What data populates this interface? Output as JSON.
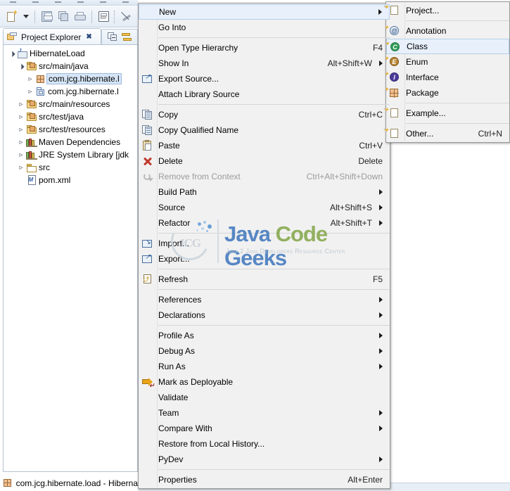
{
  "window": {
    "background_color": "#ffffff",
    "menu_bg": "#f1f1f1",
    "highlight_color": "#e8f0fb",
    "selection_color": "#d6e6f7"
  },
  "toolbar": {
    "items": [
      {
        "name": "new-wizard",
        "icon": "new-wizard-icon",
        "label": "New"
      },
      {
        "name": "new-dropdown",
        "icon": "chevron-down-icon",
        "label": ""
      },
      {
        "name": "save",
        "icon": "save-icon",
        "label": "Save"
      },
      {
        "name": "save-all",
        "icon": "save-all-icon",
        "label": "Save All"
      },
      {
        "name": "print",
        "icon": "print-icon",
        "label": "Print"
      },
      {
        "name": "binary",
        "icon": "binary-icon",
        "label": "Toggle Binary"
      },
      {
        "name": "skip-breakpoints",
        "icon": "skip-breakpoints-icon",
        "label": "Skip All Breakpoints"
      }
    ]
  },
  "view": {
    "tab_label": "Project Explorer",
    "close_glyph": "✖",
    "toolbar": [
      {
        "name": "collapse-all",
        "icon": "collapse-all-icon"
      },
      {
        "name": "link-with-editor",
        "icon": "link-with-editor-icon"
      }
    ]
  },
  "tree": {
    "items": [
      {
        "label": "HibernateLoad",
        "icon": "java-project-icon",
        "indent": 0,
        "twisty": "open",
        "selected": false
      },
      {
        "label": "src/main/java",
        "icon": "source-folder-icon",
        "indent": 1,
        "twisty": "open",
        "selected": false
      },
      {
        "label": "com.jcg.hibernate.l",
        "icon": "package-icon",
        "indent": 2,
        "twisty": "closed",
        "selected": true
      },
      {
        "label": "com.jcg.hibernate.l",
        "icon": "package-object-icon",
        "indent": 2,
        "twisty": "closed",
        "selected": false
      },
      {
        "label": "src/main/resources",
        "icon": "source-folder-icon",
        "indent": 1,
        "twisty": "closed",
        "selected": false
      },
      {
        "label": "src/test/java",
        "icon": "source-folder-icon",
        "indent": 1,
        "twisty": "closed",
        "selected": false
      },
      {
        "label": "src/test/resources",
        "icon": "source-folder-icon",
        "indent": 1,
        "twisty": "closed",
        "selected": false
      },
      {
        "label": "Maven Dependencies",
        "icon": "library-icon",
        "indent": 1,
        "twisty": "closed",
        "selected": false
      },
      {
        "label": "JRE System Library [jdk",
        "icon": "library-icon",
        "indent": 1,
        "twisty": "closed",
        "selected": false
      },
      {
        "label": "src",
        "icon": "folder-icon",
        "indent": 1,
        "twisty": "closed",
        "selected": false
      },
      {
        "label": "pom.xml",
        "icon": "xml-file-icon",
        "indent": 1,
        "twisty": "none",
        "selected": false
      }
    ]
  },
  "status_bar": {
    "icon": "package-icon",
    "text": "com.jcg.hibernate.load - Hiberna"
  },
  "context_menu": {
    "items": [
      {
        "type": "item",
        "label": "New",
        "accel": "",
        "icon": "",
        "submenu": true,
        "highlighted": true,
        "disabled": false
      },
      {
        "type": "item",
        "label": "Go Into",
        "accel": "",
        "icon": "",
        "submenu": false,
        "highlighted": false,
        "disabled": false
      },
      {
        "type": "sep"
      },
      {
        "type": "item",
        "label": "Open Type Hierarchy",
        "accel": "F4",
        "icon": "",
        "submenu": false,
        "highlighted": false,
        "disabled": false
      },
      {
        "type": "item",
        "label": "Show In",
        "accel": "Alt+Shift+W",
        "icon": "",
        "submenu": true,
        "highlighted": false,
        "disabled": false
      },
      {
        "type": "item",
        "label": "Export Source...",
        "accel": "",
        "icon": "export-source-icon",
        "submenu": false,
        "highlighted": false,
        "disabled": false
      },
      {
        "type": "item",
        "label": "Attach Library Source",
        "accel": "",
        "icon": "",
        "submenu": false,
        "highlighted": false,
        "disabled": false
      },
      {
        "type": "sep"
      },
      {
        "type": "item",
        "label": "Copy",
        "accel": "Ctrl+C",
        "icon": "copy-icon",
        "submenu": false,
        "highlighted": false,
        "disabled": false
      },
      {
        "type": "item",
        "label": "Copy Qualified Name",
        "accel": "",
        "icon": "copy-qualified-icon",
        "submenu": false,
        "highlighted": false,
        "disabled": false
      },
      {
        "type": "item",
        "label": "Paste",
        "accel": "Ctrl+V",
        "icon": "paste-icon",
        "submenu": false,
        "highlighted": false,
        "disabled": false
      },
      {
        "type": "item",
        "label": "Delete",
        "accel": "Delete",
        "icon": "delete-icon",
        "submenu": false,
        "highlighted": false,
        "disabled": false
      },
      {
        "type": "item",
        "label": "Remove from Context",
        "accel": "Ctrl+Alt+Shift+Down",
        "icon": "remove-context-icon",
        "submenu": false,
        "highlighted": false,
        "disabled": true
      },
      {
        "type": "item",
        "label": "Build Path",
        "accel": "",
        "icon": "",
        "submenu": true,
        "highlighted": false,
        "disabled": false
      },
      {
        "type": "item",
        "label": "Source",
        "accel": "Alt+Shift+S",
        "icon": "",
        "submenu": true,
        "highlighted": false,
        "disabled": false
      },
      {
        "type": "item",
        "label": "Refactor",
        "accel": "Alt+Shift+T",
        "icon": "",
        "submenu": true,
        "highlighted": false,
        "disabled": false
      },
      {
        "type": "sep"
      },
      {
        "type": "item",
        "label": "Import...",
        "accel": "",
        "icon": "import-icon",
        "submenu": false,
        "highlighted": false,
        "disabled": false
      },
      {
        "type": "item",
        "label": "Export...",
        "accel": "",
        "icon": "export-icon",
        "submenu": false,
        "highlighted": false,
        "disabled": false
      },
      {
        "type": "sep"
      },
      {
        "type": "item",
        "label": "Refresh",
        "accel": "F5",
        "icon": "refresh-icon",
        "submenu": false,
        "highlighted": false,
        "disabled": false
      },
      {
        "type": "sep"
      },
      {
        "type": "item",
        "label": "References",
        "accel": "",
        "icon": "",
        "submenu": true,
        "highlighted": false,
        "disabled": false
      },
      {
        "type": "item",
        "label": "Declarations",
        "accel": "",
        "icon": "",
        "submenu": true,
        "highlighted": false,
        "disabled": false
      },
      {
        "type": "sep"
      },
      {
        "type": "item",
        "label": "Profile As",
        "accel": "",
        "icon": "",
        "submenu": true,
        "highlighted": false,
        "disabled": false
      },
      {
        "type": "item",
        "label": "Debug As",
        "accel": "",
        "icon": "",
        "submenu": true,
        "highlighted": false,
        "disabled": false
      },
      {
        "type": "item",
        "label": "Run As",
        "accel": "",
        "icon": "",
        "submenu": true,
        "highlighted": false,
        "disabled": false
      },
      {
        "type": "item",
        "label": "Mark as Deployable",
        "accel": "",
        "icon": "deploy-icon",
        "submenu": false,
        "highlighted": false,
        "disabled": false
      },
      {
        "type": "item",
        "label": "Validate",
        "accel": "",
        "icon": "",
        "submenu": false,
        "highlighted": false,
        "disabled": false
      },
      {
        "type": "item",
        "label": "Team",
        "accel": "",
        "icon": "",
        "submenu": true,
        "highlighted": false,
        "disabled": false
      },
      {
        "type": "item",
        "label": "Compare With",
        "accel": "",
        "icon": "",
        "submenu": true,
        "highlighted": false,
        "disabled": false
      },
      {
        "type": "item",
        "label": "Restore from Local History...",
        "accel": "",
        "icon": "",
        "submenu": false,
        "highlighted": false,
        "disabled": false
      },
      {
        "type": "item",
        "label": "PyDev",
        "accel": "",
        "icon": "",
        "submenu": true,
        "highlighted": false,
        "disabled": false
      },
      {
        "type": "sep"
      },
      {
        "type": "item",
        "label": "Properties",
        "accel": "Alt+Enter",
        "icon": "",
        "submenu": false,
        "highlighted": false,
        "disabled": false
      }
    ]
  },
  "new_submenu": {
    "items": [
      {
        "type": "item",
        "label": "Project...",
        "accel": "",
        "icon": "new-project-icon",
        "highlighted": false
      },
      {
        "type": "sep"
      },
      {
        "type": "item",
        "label": "Annotation",
        "accel": "",
        "icon": "annotation-icon",
        "highlighted": false
      },
      {
        "type": "item",
        "label": "Class",
        "accel": "",
        "icon": "class-icon",
        "highlighted": true
      },
      {
        "type": "item",
        "label": "Enum",
        "accel": "",
        "icon": "enum-icon",
        "highlighted": false
      },
      {
        "type": "item",
        "label": "Interface",
        "accel": "",
        "icon": "interface-icon",
        "highlighted": false
      },
      {
        "type": "item",
        "label": "Package",
        "accel": "",
        "icon": "package-new-icon",
        "highlighted": false
      },
      {
        "type": "sep"
      },
      {
        "type": "item",
        "label": "Example...",
        "accel": "",
        "icon": "example-icon",
        "highlighted": false
      },
      {
        "type": "sep"
      },
      {
        "type": "item",
        "label": "Other...",
        "accel": "Ctrl+N",
        "icon": "other-icon",
        "highlighted": false
      }
    ]
  },
  "watermark": {
    "logo_text": "JCG",
    "title_1": "Java",
    "title_2": "Code",
    "title_3": "Geeks",
    "subtitle": "Java 2 Java Developers Resource Center",
    "color_blue": "#4a7fc1",
    "color_green": "#8aab52"
  }
}
